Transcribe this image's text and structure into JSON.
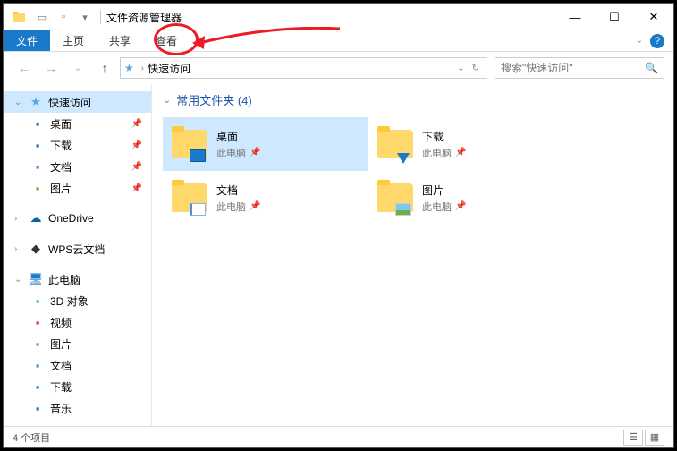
{
  "title": "文件资源管理器",
  "ribbon": {
    "file": "文件",
    "tabs": [
      "主页",
      "共享",
      "查看"
    ]
  },
  "address": {
    "root": "快速访问",
    "search_placeholder": "搜索\"快速访问\""
  },
  "sidebar": {
    "quick_access": "快速访问",
    "quick_items": [
      {
        "label": "桌面",
        "icon": "desktop",
        "color": "#1979ca"
      },
      {
        "label": "下载",
        "icon": "download",
        "color": "#1979ca"
      },
      {
        "label": "文档",
        "icon": "document",
        "color": "#4a90d9"
      },
      {
        "label": "图片",
        "icon": "picture",
        "color": "#6ab04c"
      }
    ],
    "onedrive": "OneDrive",
    "wps": "WPS云文档",
    "this_pc": "此电脑",
    "pc_items": [
      {
        "label": "3D 对象",
        "color": "#3bb"
      },
      {
        "label": "视频",
        "color": "#c44"
      },
      {
        "label": "图片",
        "color": "#6ab04c"
      },
      {
        "label": "文档",
        "color": "#4a90d9"
      },
      {
        "label": "下载",
        "color": "#1979ca"
      },
      {
        "label": "音乐",
        "color": "#1979ca"
      }
    ]
  },
  "content": {
    "group_title": "常用文件夹 (4)",
    "tiles": [
      {
        "name": "桌面",
        "location": "此电脑",
        "overlay": "desktop",
        "selected": true
      },
      {
        "name": "下载",
        "location": "此电脑",
        "overlay": "download",
        "selected": false
      },
      {
        "name": "文档",
        "location": "此电脑",
        "overlay": "doc",
        "selected": false
      },
      {
        "name": "图片",
        "location": "此电脑",
        "overlay": "pic",
        "selected": false
      }
    ]
  },
  "status": "4 个项目"
}
